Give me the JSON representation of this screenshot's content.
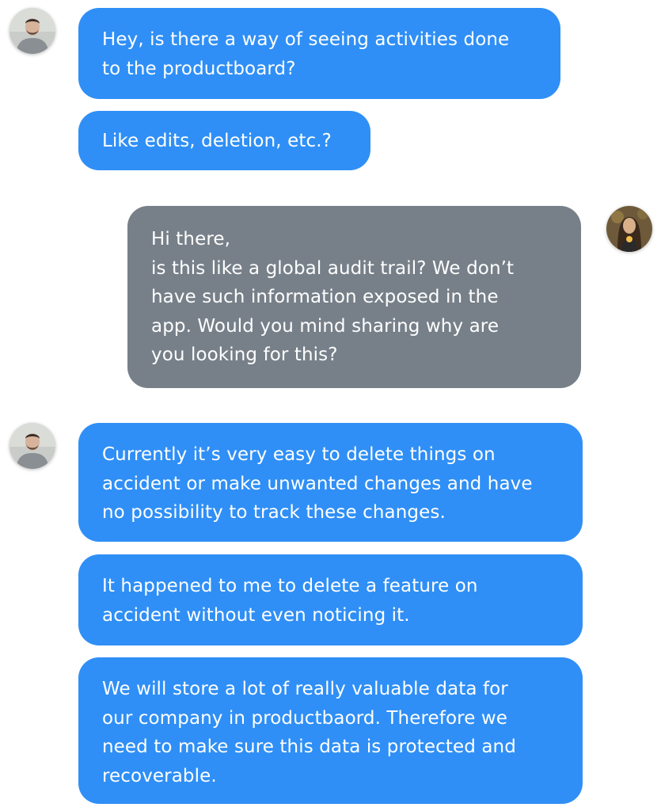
{
  "conversation": {
    "colors": {
      "customer_bubble": "#2f8ff6",
      "agent_bubble": "#778089",
      "text": "#ffffff",
      "background": "#ffffff"
    },
    "messages": [
      {
        "sender": "customer",
        "text": "Hey, is there a way of seeing activities done\nto the productboard?"
      },
      {
        "sender": "customer",
        "text": "Like edits, deletion, etc.?"
      },
      {
        "sender": "agent",
        "text": "Hi there,\nis this like a global audit trail? We don’t\nhave such information exposed in the\napp. Would you mind sharing why are\nyou looking for this?"
      },
      {
        "sender": "customer",
        "text": "Currently it’s very easy to delete things on\naccident or make unwanted changes and have\nno possibility to track these changes."
      },
      {
        "sender": "customer",
        "text": "It happened to me to delete a feature on\naccident without even noticing it."
      },
      {
        "sender": "customer",
        "text": "We will store a lot of really valuable data for\nour company in productbaord. Therefore we\nneed to make sure this data is protected and\nrecoverable."
      }
    ]
  }
}
